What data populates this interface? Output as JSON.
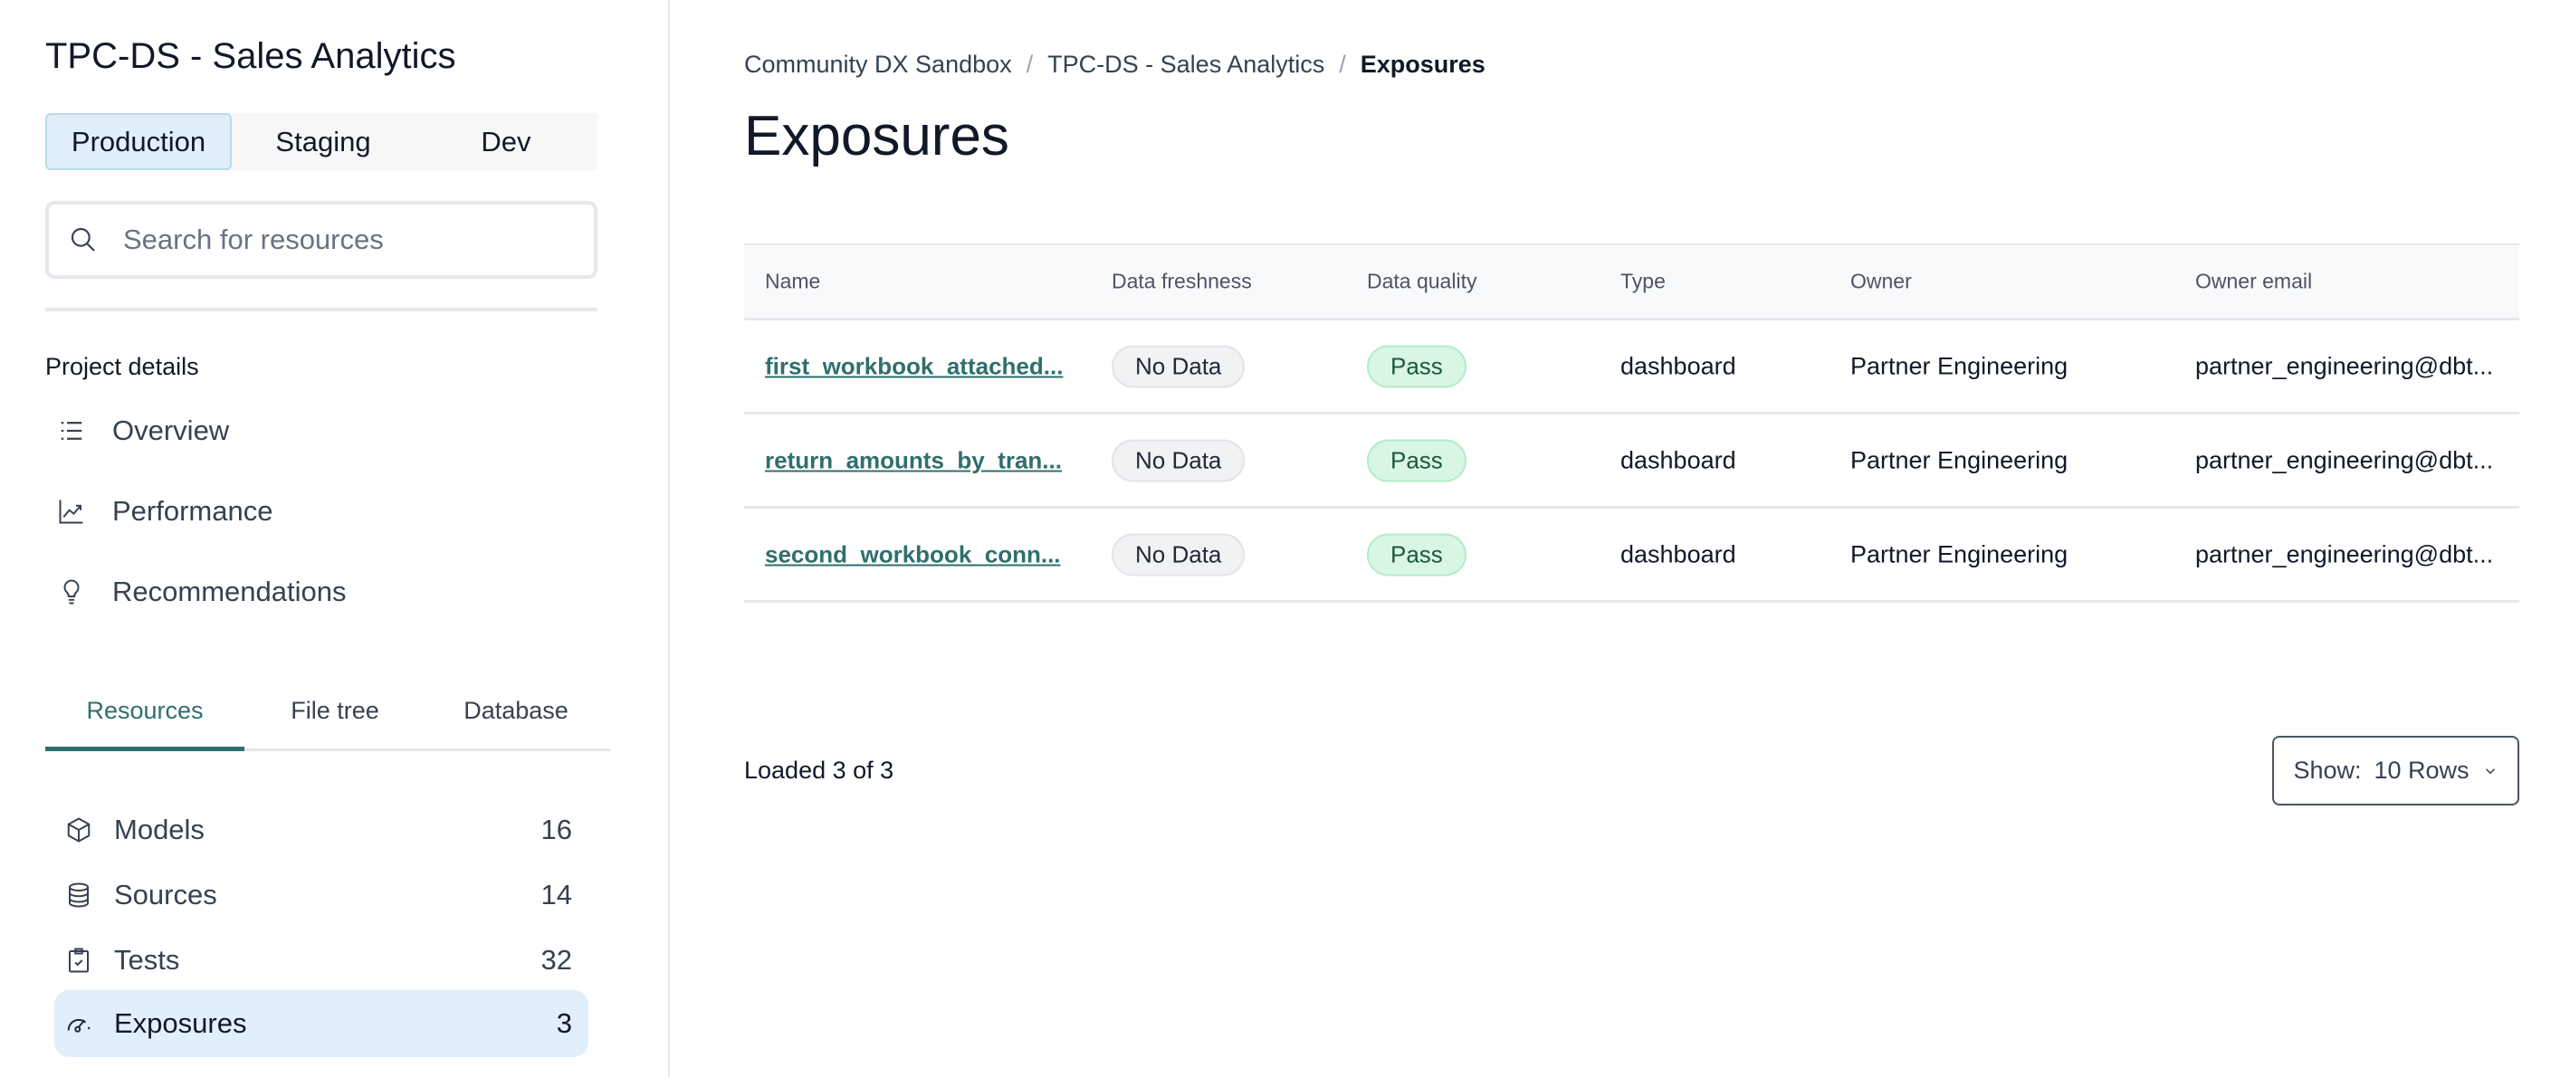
{
  "sidebar": {
    "project_title": "TPC-DS - Sales Analytics",
    "environments": [
      "Production",
      "Staging",
      "Dev"
    ],
    "active_environment": "Production",
    "search_placeholder": "Search for resources",
    "project_details_label": "Project details",
    "nav": [
      {
        "label": "Overview",
        "icon": "list-icon"
      },
      {
        "label": "Performance",
        "icon": "chart-line-icon"
      },
      {
        "label": "Recommendations",
        "icon": "lightbulb-icon"
      }
    ],
    "tabs": [
      "Resources",
      "File tree",
      "Database"
    ],
    "active_tab": "Resources",
    "resources": [
      {
        "label": "Models",
        "count": "16",
        "icon": "cube-icon"
      },
      {
        "label": "Sources",
        "count": "14",
        "icon": "database-icon"
      },
      {
        "label": "Tests",
        "count": "32",
        "icon": "clipboard-check-icon"
      },
      {
        "label": "Exposures",
        "count": "3",
        "icon": "gauge-icon"
      }
    ],
    "accent": "#2f6f6e",
    "active_bg": "#e1effb"
  },
  "main": {
    "breadcrumb": [
      "Community DX Sandbox",
      "TPC-DS - Sales Analytics",
      "Exposures"
    ],
    "title": "Exposures",
    "table": {
      "columns": [
        "Name",
        "Data freshness",
        "Data quality",
        "Type",
        "Owner",
        "Owner email"
      ],
      "rows": [
        [
          "first_workbook_attached...",
          "No Data",
          "Pass",
          "dashboard",
          "Partner Engineering",
          "partner_engineering@dbt..."
        ],
        [
          "return_amounts_by_tran...",
          "No Data",
          "Pass",
          "dashboard",
          "Partner Engineering",
          "partner_engineering@dbt..."
        ],
        [
          "second_workbook_conn...",
          "No Data",
          "Pass",
          "dashboard",
          "Partner Engineering",
          "partner_engineering@dbt..."
        ]
      ]
    },
    "loaded_text": "Loaded 3 of 3",
    "show_label": "Show:",
    "show_value": "10 Rows"
  }
}
